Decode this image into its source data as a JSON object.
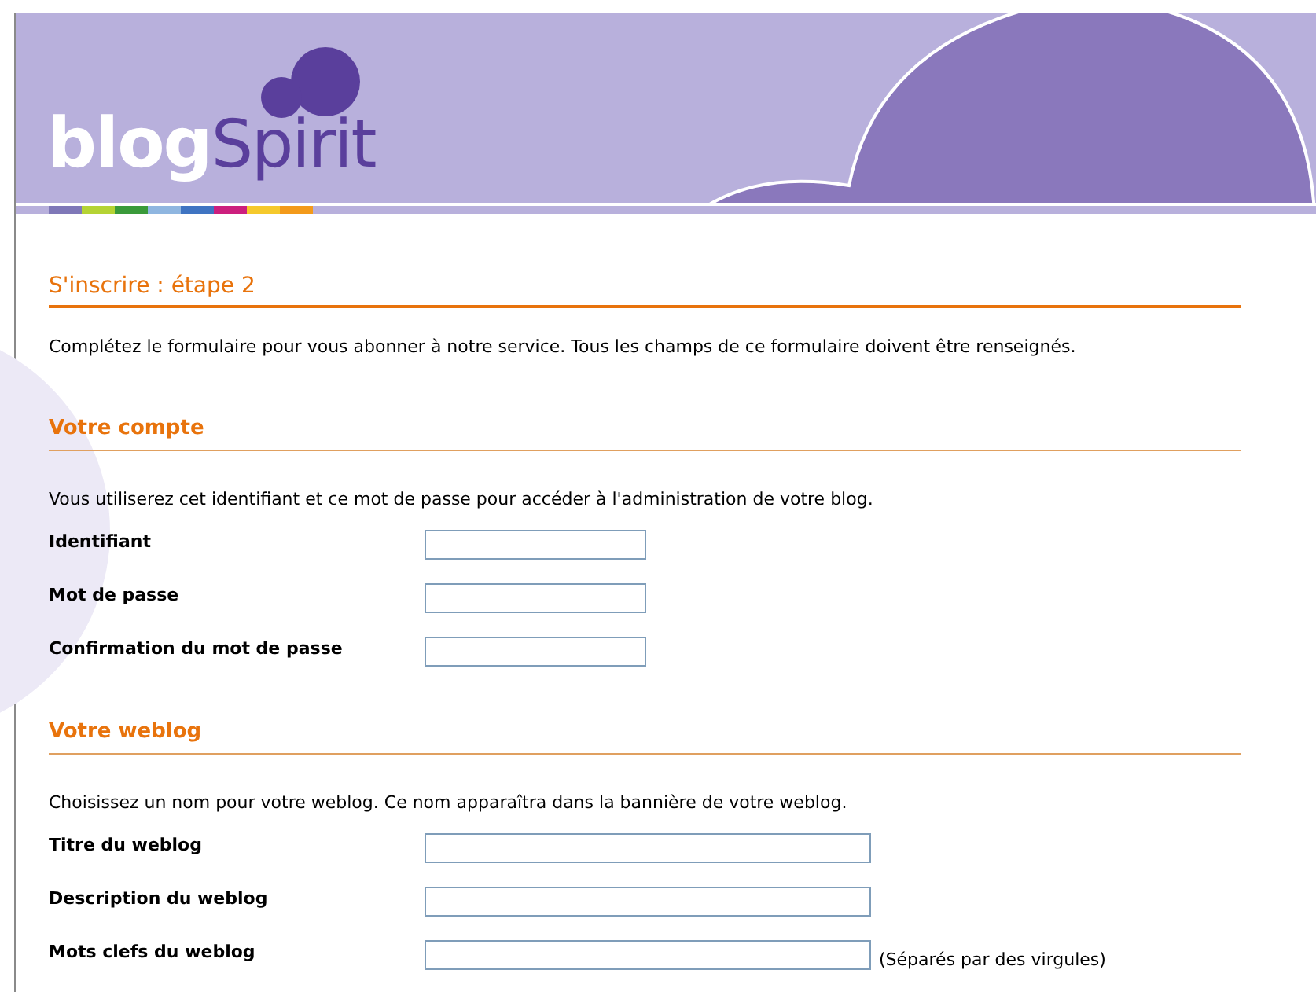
{
  "logo": {
    "part_1": "blog",
    "part_2": "Spirit"
  },
  "page_title": "S'inscrire : étape 2",
  "intro": "Complétez le formulaire pour vous abonner à notre service. Tous les champs de ce formulaire doivent être renseignés.",
  "sections": [
    {
      "heading": "Votre compte",
      "description": "Vous utiliserez cet identifiant et ce mot de passe pour accéder à l'administration de votre blog.",
      "fields": [
        {
          "label": "Identifiant",
          "kind": "short"
        },
        {
          "label": "Mot de passe",
          "kind": "short"
        },
        {
          "label": "Confirmation du mot de passe",
          "kind": "short"
        }
      ]
    },
    {
      "heading": "Votre weblog",
      "description": "Choisissez un nom pour votre weblog. Ce nom apparaîtra dans la bannière de votre weblog.",
      "fields": [
        {
          "label": "Titre du weblog",
          "kind": "long"
        },
        {
          "label": "Description du weblog",
          "kind": "long"
        },
        {
          "label": "Mots clefs du weblog",
          "kind": "long",
          "hint": "(Séparés par des virgules)"
        }
      ]
    }
  ]
}
